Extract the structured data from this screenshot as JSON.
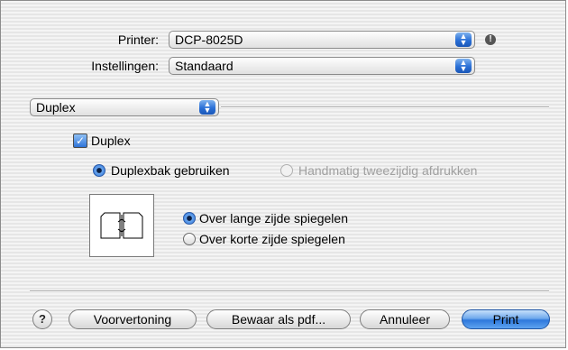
{
  "printer": {
    "label": "Printer:",
    "value": "DCP-8025D"
  },
  "settings": {
    "label": "Instellingen:",
    "value": "Standaard"
  },
  "panel_popup": {
    "value": "Duplex"
  },
  "duplex_checkbox": {
    "label": "Duplex",
    "checked": true
  },
  "mode": {
    "options": [
      "Duplexbak gebruiken",
      "Handmatig tweezijdig afdrukken"
    ],
    "selected": "Duplexbak gebruiken"
  },
  "binding": {
    "options": [
      "Over lange zijde spiegelen",
      "Over korte zijde spiegelen"
    ],
    "selected": "Over lange zijde spiegelen"
  },
  "buttons": {
    "help": "?",
    "preview": "Voorvertoning",
    "save_pdf": "Bewaar als pdf...",
    "cancel": "Annuleer",
    "print": "Print"
  },
  "icons": {
    "warning": "exclamation-icon",
    "popup_arrows": "updown-arrows-icon",
    "duplex_preview": "long-edge-binding-icon"
  },
  "colors": {
    "accent": "#2f74d8",
    "disabled_text": "#a0a0a0"
  }
}
